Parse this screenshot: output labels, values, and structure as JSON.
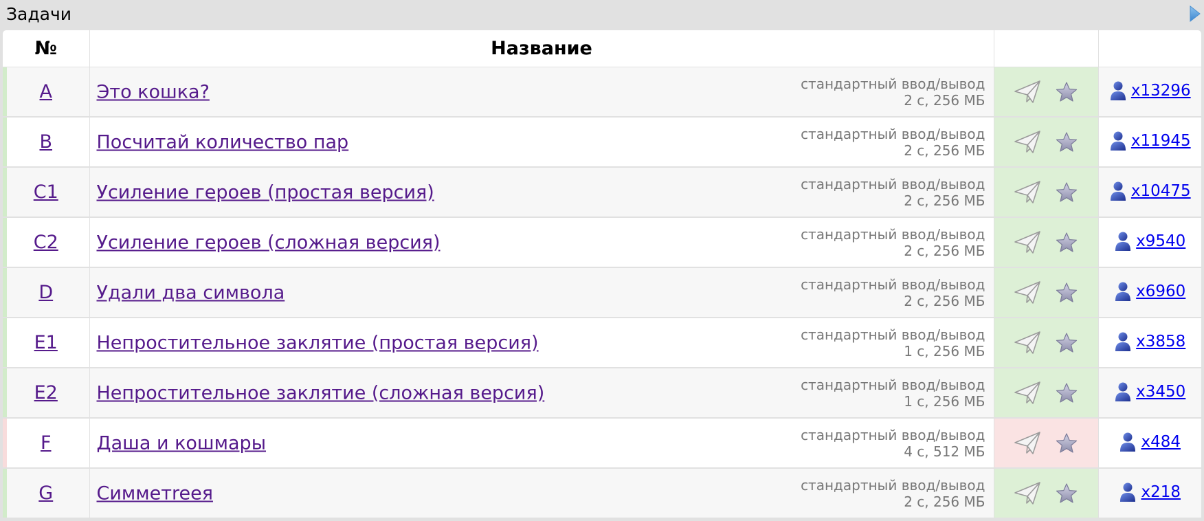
{
  "panel": {
    "title": "Задачи"
  },
  "table": {
    "headers": {
      "num": "№",
      "name": "Название",
      "actions": "",
      "solved": ""
    },
    "rows": [
      {
        "id": "A",
        "name": "Это кошка?",
        "io": "стандартный ввод/вывод",
        "limits": "2 с, 256 МБ",
        "solved": "x13296",
        "status": "ok"
      },
      {
        "id": "B",
        "name": "Посчитай количество пар",
        "io": "стандартный ввод/вывод",
        "limits": "2 с, 256 МБ",
        "solved": "x11945",
        "status": "ok"
      },
      {
        "id": "C1",
        "name": "Усиление героев (простая версия)",
        "io": "стандартный ввод/вывод",
        "limits": "2 с, 256 МБ",
        "solved": "x10475",
        "status": "ok"
      },
      {
        "id": "C2",
        "name": "Усиление героев (сложная версия)",
        "io": "стандартный ввод/вывод",
        "limits": "2 с, 256 МБ",
        "solved": "x9540",
        "status": "ok"
      },
      {
        "id": "D",
        "name": "Удали два символа",
        "io": "стандартный ввод/вывод",
        "limits": "2 с, 256 МБ",
        "solved": "x6960",
        "status": "ok"
      },
      {
        "id": "E1",
        "name": "Непростительное заклятие (простая версия)",
        "io": "стандартный ввод/вывод",
        "limits": "1 с, 256 МБ",
        "solved": "x3858",
        "status": "ok"
      },
      {
        "id": "E2",
        "name": "Непростительное заклятие (сложная версия)",
        "io": "стандартный ввод/вывод",
        "limits": "1 с, 256 МБ",
        "solved": "x3450",
        "status": "ok"
      },
      {
        "id": "F",
        "name": "Даша и кошмары",
        "io": "стандартный ввод/вывод",
        "limits": "4 с, 512 МБ",
        "solved": "x484",
        "status": "fail"
      },
      {
        "id": "G",
        "name": "Симметreeя",
        "io": "стандартный ввод/вывод",
        "limits": "2 с, 256 МБ",
        "solved": "x218",
        "status": "ok"
      }
    ]
  },
  "colors": {
    "accepted": "#ddf0d6",
    "accepted_bar": "#d2ecca",
    "rejected": "#fae3e3",
    "rejected_bar": "#f8dcdc",
    "visited_link": "#551a8b",
    "link": "#0000ee"
  },
  "icons": {
    "collapse": "triangle-right-icon",
    "submit": "paper-plane-icon",
    "favourite": "star-icon",
    "solvers": "user-icon"
  }
}
